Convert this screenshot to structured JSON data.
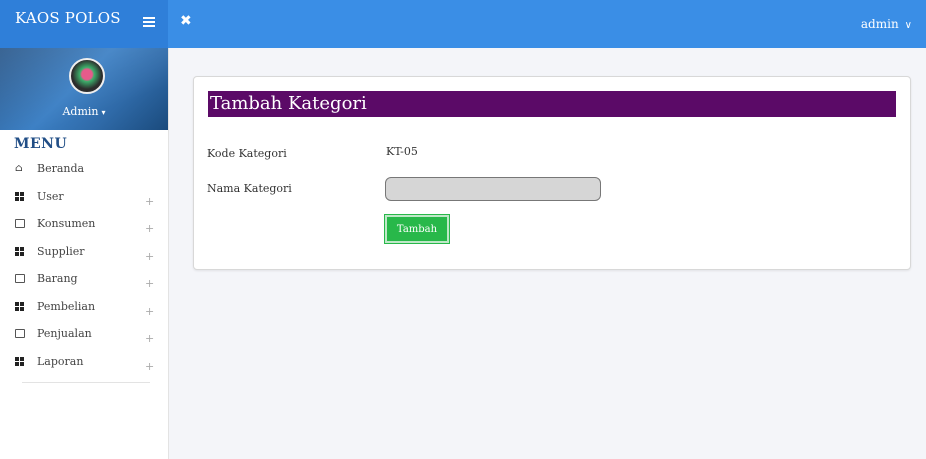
{
  "header": {
    "brand": "KAOS POLOS",
    "user": "admin"
  },
  "sidebar": {
    "profile_name": "Admin",
    "menu_title": "MENU",
    "items": [
      {
        "label": "Beranda",
        "icon": "home-icon",
        "expandable": false
      },
      {
        "label": "User",
        "icon": "grid-icon",
        "expandable": true
      },
      {
        "label": "Konsumen",
        "icon": "window-icon",
        "expandable": true
      },
      {
        "label": "Supplier",
        "icon": "grid-icon",
        "expandable": true
      },
      {
        "label": "Barang",
        "icon": "window-icon",
        "expandable": true
      },
      {
        "label": "Pembelian",
        "icon": "grid-icon",
        "expandable": true
      },
      {
        "label": "Penjualan",
        "icon": "window-icon",
        "expandable": true
      },
      {
        "label": "Laporan",
        "icon": "grid-icon",
        "expandable": true
      }
    ],
    "expand_symbol": "+"
  },
  "form": {
    "title": "Tambah Kategori",
    "kode_label": "Kode Kategori",
    "kode_value": "KT-05",
    "nama_label": "Nama Kategori",
    "nama_value": "",
    "submit_label": "Tambah"
  },
  "colors": {
    "topbar": "#3a8ee6",
    "card_title_bg": "#5b0a67",
    "submit_bg": "#28b84a",
    "menu_title": "#214e86"
  }
}
